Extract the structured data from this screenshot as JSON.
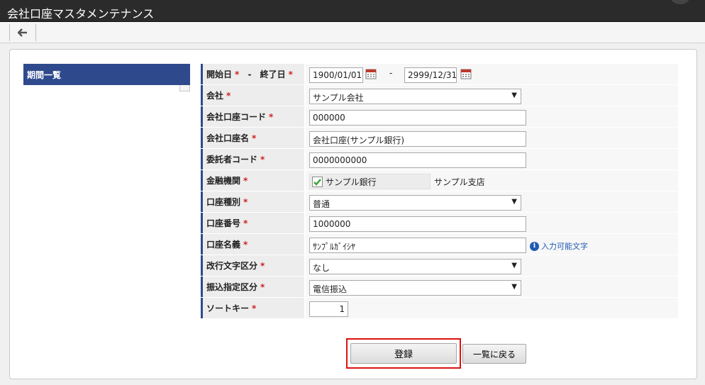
{
  "app": {
    "title": "会社口座マスタメンテナンス"
  },
  "toolbar": {
    "back_icon": "arrow-left-icon"
  },
  "sidebar": {
    "header": "期間一覧"
  },
  "form": {
    "required_mark": "*",
    "period": {
      "start_label": "開始日",
      "separator": "-",
      "end_label": "終了日",
      "start_value": "1900/01/01",
      "end_value": "2999/12/31",
      "range_dash": "-"
    },
    "company": {
      "label": "会社",
      "value": "サンプル会社"
    },
    "account_code": {
      "label": "会社口座コード",
      "value": "000000"
    },
    "account_name": {
      "label": "会社口座名",
      "value": "会社口座(サンプル銀行)"
    },
    "consignor_code": {
      "label": "委託者コード",
      "value": "0000000000"
    },
    "institution": {
      "label": "金融機関",
      "bank": "サンプル銀行",
      "branch": "サンプル支店"
    },
    "account_type": {
      "label": "口座種別",
      "value": "普通"
    },
    "account_number": {
      "label": "口座番号",
      "value": "1000000"
    },
    "account_holder": {
      "label": "口座名義",
      "value": "ｻﾝﾌﾟﾙｶﾞｲｼﾔ",
      "help_link": "入力可能文字"
    },
    "newline_type": {
      "label": "改行文字区分",
      "value": "なし"
    },
    "transfer_type": {
      "label": "振込指定区分",
      "value": "電信振込"
    },
    "sort_key": {
      "label": "ソートキー",
      "value": "1"
    }
  },
  "actions": {
    "register": "登録",
    "back_to_list": "一覧に戻る"
  },
  "colors": {
    "titlebar": "#2b2b2b",
    "accent": "#2f4a8c",
    "required": "#d02020",
    "highlight": "#dd1111",
    "link": "#1f5bb5"
  }
}
